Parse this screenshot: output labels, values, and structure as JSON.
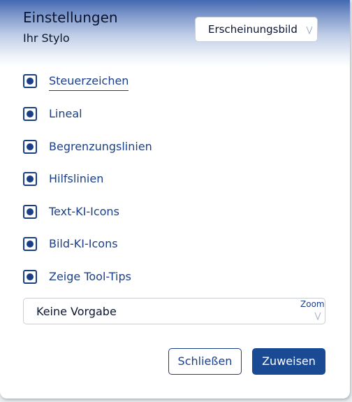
{
  "dialog": {
    "title": "Einstellungen",
    "subtitle": "Ihr Stylo",
    "appearance_select": {
      "value": "Erscheinungsbild",
      "icon": "chevron-down-icon"
    }
  },
  "options": [
    {
      "label": "Steuerzeichen",
      "checked": true,
      "focused": true
    },
    {
      "label": "Lineal",
      "checked": true
    },
    {
      "label": "Begrenzungslinien",
      "checked": true
    },
    {
      "label": "Hilfslinien",
      "checked": true
    },
    {
      "label": "Text-KI-Icons",
      "checked": true
    },
    {
      "label": "Bild-KI-Icons",
      "checked": true
    },
    {
      "label": "Zeige Tool-Tips",
      "checked": true
    }
  ],
  "zoom": {
    "label": "Zoom",
    "value": "Keine Vorgabe",
    "icon": "chevron-down-icon"
  },
  "buttons": {
    "close_label": "Schließen",
    "apply_label": "Zuweisen"
  },
  "colors": {
    "accent": "#1b3f87",
    "primary_button": "#1b4a94",
    "header_gradient_top": "#4468b0"
  }
}
